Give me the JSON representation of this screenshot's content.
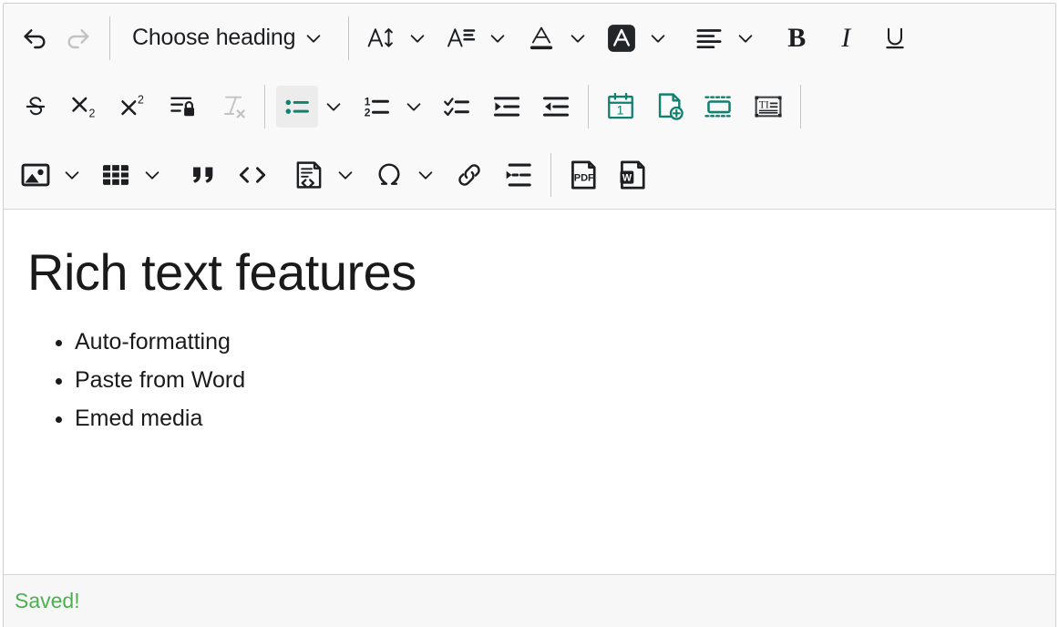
{
  "editor": {
    "heading_select": {
      "label": "Choose heading",
      "caret": "chevron-down-icon"
    },
    "toolbar_rows": [
      {
        "name": "toolbar-row-1",
        "items": [
          {
            "name": "undo-button",
            "icon": "undo-icon",
            "label": "Undo",
            "state": "enabled"
          },
          {
            "name": "redo-button",
            "icon": "redo-icon",
            "label": "Redo",
            "state": "disabled"
          },
          {
            "name": "heading-select",
            "icon": "heading-select-icon",
            "label": "Choose heading",
            "state": "enabled"
          },
          {
            "name": "font-size-button",
            "icon": "font-size-icon",
            "label": "Font Size",
            "state": "enabled"
          },
          {
            "name": "font-family-button",
            "icon": "font-family-icon",
            "label": "Font Family",
            "state": "enabled"
          },
          {
            "name": "font-color-button",
            "icon": "font-color-icon",
            "label": "Font Color",
            "state": "enabled"
          },
          {
            "name": "highlight-button",
            "icon": "highlight-icon",
            "label": "Highlight",
            "state": "enabled"
          },
          {
            "name": "alignment-button",
            "icon": "align-left-icon",
            "label": "Text alignment",
            "state": "enabled"
          },
          {
            "name": "bold-button",
            "icon": "bold-icon",
            "label": "Bold",
            "state": "enabled"
          },
          {
            "name": "italic-button",
            "icon": "italic-icon",
            "label": "Italic",
            "state": "enabled"
          },
          {
            "name": "underline-button",
            "icon": "underline-icon",
            "label": "Underline",
            "state": "enabled"
          }
        ]
      },
      {
        "name": "toolbar-row-2",
        "items": [
          {
            "name": "strikethrough-button",
            "icon": "strikethrough-icon",
            "label": "Strikethrough",
            "state": "enabled"
          },
          {
            "name": "subscript-button",
            "icon": "subscript-icon",
            "label": "Subscript",
            "state": "enabled"
          },
          {
            "name": "superscript-button",
            "icon": "superscript-icon",
            "label": "Superscript",
            "state": "enabled"
          },
          {
            "name": "restricted-editing-button",
            "icon": "lock-paragraph-icon",
            "label": "Restricted editing",
            "state": "enabled"
          },
          {
            "name": "remove-format-button",
            "icon": "remove-format-icon",
            "label": "Remove Format",
            "state": "disabled"
          },
          {
            "name": "bulleted-list-button",
            "icon": "bulleted-list-icon",
            "label": "Bulleted List",
            "state": "active"
          },
          {
            "name": "numbered-list-button",
            "icon": "numbered-list-icon",
            "label": "Numbered List",
            "state": "enabled"
          },
          {
            "name": "todo-list-button",
            "icon": "todo-list-icon",
            "label": "To-do List",
            "state": "enabled"
          },
          {
            "name": "increase-indent-button",
            "icon": "increase-indent-icon",
            "label": "Increase Indent",
            "state": "enabled"
          },
          {
            "name": "decrease-indent-button",
            "icon": "decrease-indent-icon",
            "label": "Decrease Indent",
            "state": "enabled"
          },
          {
            "name": "insert-date-button",
            "icon": "calendar-icon",
            "label": "Insert Date",
            "state": "teal"
          },
          {
            "name": "insert-page-button",
            "icon": "page-add-icon",
            "label": "Insert Page",
            "state": "teal"
          },
          {
            "name": "insert-textbox-button",
            "icon": "text-box-icon",
            "label": "Insert Text Box",
            "state": "teal"
          },
          {
            "name": "insert-template-button",
            "icon": "template-icon",
            "label": "Insert Template",
            "state": "enabled"
          }
        ]
      },
      {
        "name": "toolbar-row-3",
        "items": [
          {
            "name": "insert-image-button",
            "icon": "image-icon",
            "label": "Insert Image",
            "state": "enabled"
          },
          {
            "name": "insert-table-button",
            "icon": "table-icon",
            "label": "Insert Table",
            "state": "enabled"
          },
          {
            "name": "blockquote-button",
            "icon": "quote-icon",
            "label": "Block Quote",
            "state": "enabled"
          },
          {
            "name": "inline-code-button",
            "icon": "code-icon",
            "label": "Code",
            "state": "enabled"
          },
          {
            "name": "code-block-button",
            "icon": "code-block-icon",
            "label": "Code Block",
            "state": "enabled"
          },
          {
            "name": "special-character-button",
            "icon": "omega-icon",
            "label": "Special Characters",
            "state": "enabled"
          },
          {
            "name": "insert-link-button",
            "icon": "link-icon",
            "label": "Link",
            "state": "enabled"
          },
          {
            "name": "page-break-button",
            "icon": "page-break-icon",
            "label": "Page Break",
            "state": "enabled"
          },
          {
            "name": "export-pdf-button",
            "icon": "pdf-icon",
            "label": "Export to PDF",
            "state": "enabled"
          },
          {
            "name": "export-word-button",
            "icon": "word-icon",
            "label": "Export to Word",
            "state": "enabled"
          }
        ]
      }
    ],
    "document": {
      "title": "Rich text features",
      "list_items": [
        "Auto-formatting",
        "Paste from Word",
        "Emed media"
      ]
    },
    "statusbar": {
      "message": "Saved!"
    }
  },
  "colors": {
    "accent_teal": "#12806f",
    "saved_green": "#4caf50",
    "toolbar_bg": "#f9f9f9",
    "icon_dark": "#1c1e21",
    "icon_disabled": "#bdbdbd",
    "border": "#d4d4d4"
  }
}
